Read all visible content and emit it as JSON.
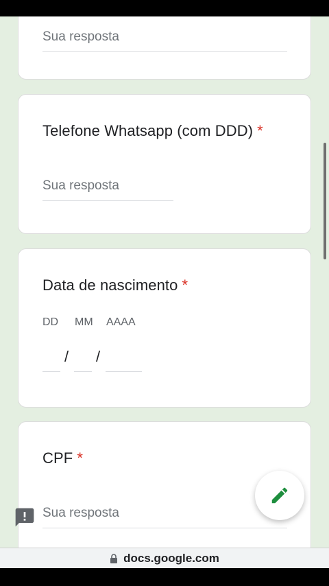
{
  "questions": [
    {
      "title": "",
      "required": false,
      "placeholder": "Sua resposta"
    },
    {
      "title": "Telefone Whatsapp (com DDD)",
      "required_marker": "*",
      "placeholder": "Sua resposta"
    },
    {
      "title": "Data de nascimento",
      "required_marker": "*",
      "date_labels": [
        "DD",
        "MM",
        "AAAA"
      ],
      "separator": "/"
    },
    {
      "title": "CPF",
      "required_marker": "*",
      "placeholder": "Sua resposta"
    }
  ],
  "browser": {
    "url": "docs.google.com"
  },
  "icons": {
    "fab": "pencil-icon",
    "feedback": "report-icon",
    "lock": "lock-icon"
  },
  "colors": {
    "required": "#d93025",
    "accent": "#1e8e3e",
    "background": "#e4efe1"
  }
}
